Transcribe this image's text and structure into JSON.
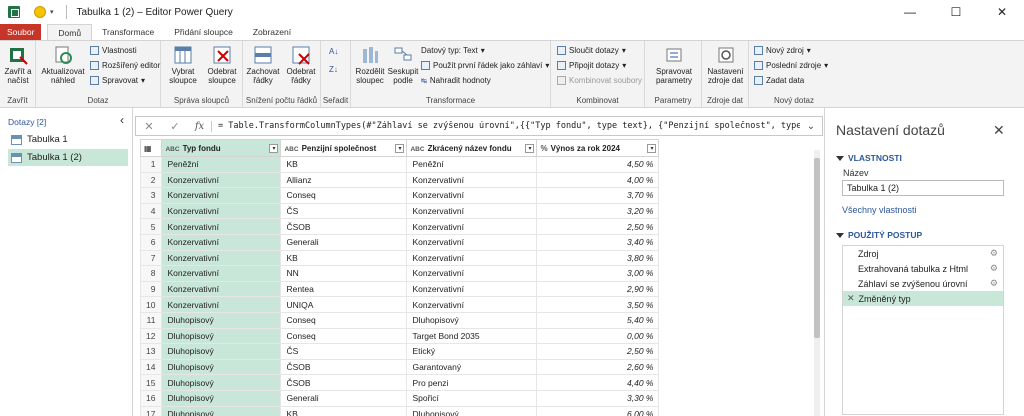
{
  "window": {
    "title": "Tabulka 1 (2) – Editor Power Query",
    "minimize": "—",
    "maximize": "☐",
    "close": "✕"
  },
  "tabs": [
    "Soubor",
    "Domů",
    "Transformace",
    "Přidání sloupce",
    "Zobrazení"
  ],
  "ribbon": {
    "close_apply": "Zavřít a\nnačíst",
    "refresh_preview": "Aktualizovat\nnáhled",
    "properties": "Vlastnosti",
    "advanced_editor": "Rozšířený editor",
    "manage": "Spravovat",
    "choose_columns": "Vybrat\nsloupce",
    "remove_columns": "Odebrat\nsloupce",
    "keep_rows": "Zachovat\nřádky",
    "remove_rows": "Odebrat\nřádky",
    "split_column": "Rozdělit\nsloupec",
    "group_by": "Seskupit\npodle",
    "data_type": "Datový typ: Text",
    "use_first_row": "Použít první řádek jako záhlaví",
    "replace_values": "Nahradit hodnoty",
    "merge_queries": "Sloučit dotazy",
    "append_queries": "Připojit dotazy",
    "combine_files": "Kombinovat soubory",
    "manage_parameters": "Spravovat\nparametry",
    "data_source_settings": "Nastavení\nzdroje dat",
    "new_source": "Nový zdroj",
    "recent_sources": "Poslední zdroje",
    "enter_data": "Zadat data",
    "groups": {
      "close": "Zavřít",
      "query": "Dotaz",
      "manage_columns": "Správa sloupců",
      "reduce_rows": "Snížení počtu řádků",
      "sort": "Seřadit",
      "transform": "Transformace",
      "combine": "Kombinovat",
      "parameters": "Parametry",
      "data_sources": "Zdroje dat",
      "new_query": "Nový dotaz"
    }
  },
  "queries": {
    "header": "Dotazy [2]",
    "items": [
      "Tabulka 1",
      "Tabulka 1 (2)"
    ]
  },
  "formula": "= Table.TransformColumnTypes(#\"Záhlaví se zvýšenou úrovní\",{{\"Typ fondu\", type text}, {\"Penzijní společnost\", type",
  "grid": {
    "columns": [
      {
        "label": "Typ fondu",
        "type_icon": "ABC"
      },
      {
        "label": "Penzijní společnost",
        "type_icon": "ABC"
      },
      {
        "label": "Zkrácený název fondu",
        "type_icon": "ABC"
      },
      {
        "label": "Výnos za rok 2024",
        "type_icon": "%"
      }
    ],
    "rows": [
      [
        "1",
        "Peněžní",
        "KB",
        "Peněžní",
        "4,50 %"
      ],
      [
        "2",
        "Konzervativní",
        "Allianz",
        "Konzervativní",
        "4,00 %"
      ],
      [
        "3",
        "Konzervativní",
        "Conseq",
        "Konzervativní",
        "3,70 %"
      ],
      [
        "4",
        "Konzervativní",
        "ČS",
        "Konzervativní",
        "3,20 %"
      ],
      [
        "5",
        "Konzervativní",
        "ČSOB",
        "Konzervativní",
        "2,50 %"
      ],
      [
        "6",
        "Konzervativní",
        "Generali",
        "Konzervativní",
        "3,40 %"
      ],
      [
        "7",
        "Konzervativní",
        "KB",
        "Konzervativní",
        "3,80 %"
      ],
      [
        "8",
        "Konzervativní",
        "NN",
        "Konzervativní",
        "3,00 %"
      ],
      [
        "9",
        "Konzervativní",
        "Rentea",
        "Konzervativní",
        "2,90 %"
      ],
      [
        "10",
        "Konzervativní",
        "UNIQA",
        "Konzervativní",
        "3,50 %"
      ],
      [
        "11",
        "Dluhopisový",
        "Conseq",
        "Dluhopisový",
        "5,40 %"
      ],
      [
        "12",
        "Dluhopisový",
        "Conseq",
        "Target Bond 2035",
        "0,00 %"
      ],
      [
        "13",
        "Dluhopisový",
        "ČS",
        "Etický",
        "2,50 %"
      ],
      [
        "14",
        "Dluhopisový",
        "ČSOB",
        "Garantovaný",
        "2,60 %"
      ],
      [
        "15",
        "Dluhopisový",
        "ČSOB",
        "Pro penzi",
        "4,40 %"
      ],
      [
        "16",
        "Dluhopisový",
        "Generali",
        "Spořicí",
        "3,30 %"
      ],
      [
        "17",
        "Dluhopisový",
        "KB",
        "Dluhopisový",
        "6,00 %"
      ]
    ]
  },
  "settings": {
    "title": "Nastavení dotazů",
    "close": "✕",
    "properties_header": "VLASTNOSTI",
    "name_label": "Název",
    "name_value": "Tabulka 1 (2)",
    "all_properties": "Všechny vlastnosti",
    "steps_header": "POUŽITÝ POSTUP",
    "steps": [
      "Zdroj",
      "Extrahovaná tabulka z Html",
      "Záhlaví se zvýšenou úrovní",
      "Změněný typ"
    ]
  },
  "colors": {
    "file_tab": "#c63528",
    "accent_blue": "#2b579a",
    "selected_green": "#c9e7d9"
  }
}
